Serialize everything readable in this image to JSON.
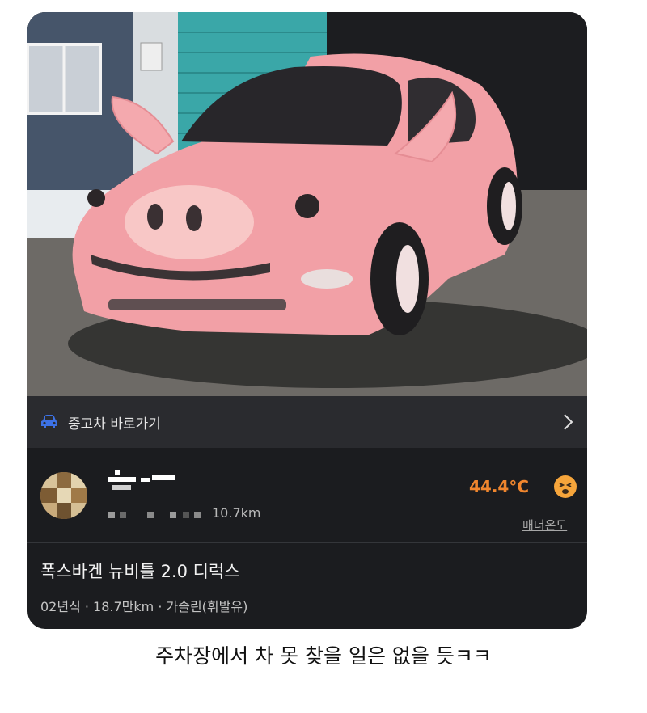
{
  "shortcut": {
    "label": "중고차 바로가기",
    "icon": "car-icon"
  },
  "seller": {
    "distance": "10.7km",
    "temperature": "44.4°C",
    "manner_label": "매너온도"
  },
  "listing": {
    "title": "폭스바겐 뉴비틀 2.0 디럭스",
    "details": "02년식 · 18.7만km · 가솔린(휘발유)"
  },
  "caption": "주차장에서 차 못 찾을 일은 없을 듯ㅋㅋ",
  "colors": {
    "accent_temp": "#f0862e",
    "card_bg": "#1b1c1f",
    "car_pink": "#f2a0a6"
  }
}
